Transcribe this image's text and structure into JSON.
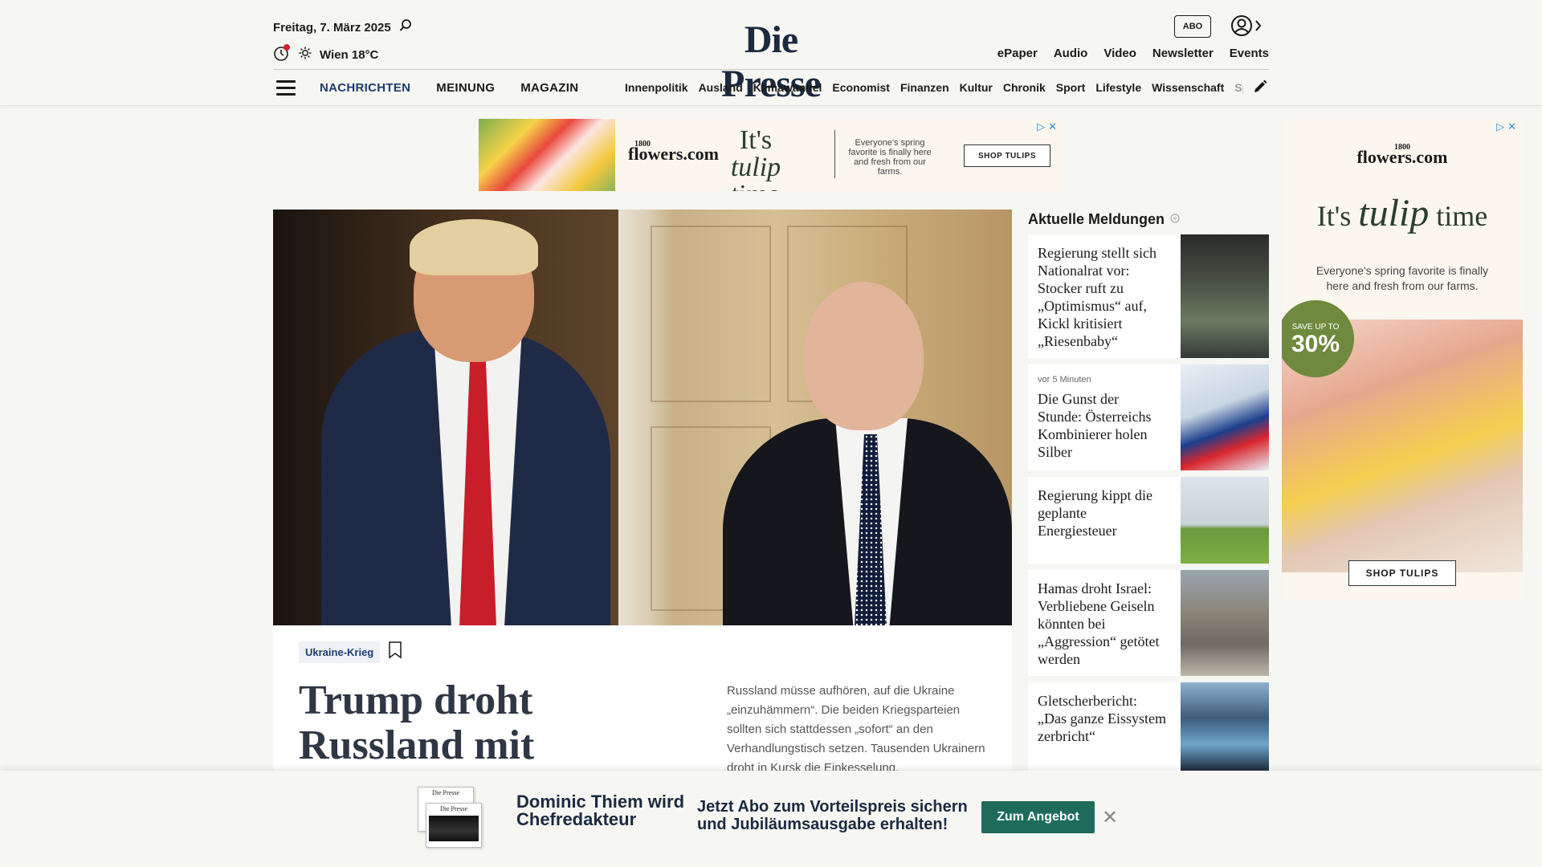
{
  "header": {
    "date": "Freitag, 7. März 2025",
    "weather": "Wien 18°C",
    "logo": "Die Presse",
    "abo_label": "ABO",
    "util_links": [
      "ePaper",
      "Audio",
      "Video",
      "Newsletter",
      "Events"
    ],
    "main_nav": [
      "NACHRICHTEN",
      "MEINUNG",
      "MAGAZIN"
    ],
    "sub_nav": [
      "Innenpolitik",
      "Ausland",
      "Klimawandel",
      "Economist",
      "Finanzen",
      "Kultur",
      "Chronik",
      "Sport",
      "Lifestyle",
      "Wissenschaft",
      "Spectr"
    ]
  },
  "top_ad": {
    "brand_small": "1800",
    "brand": "flowers.com",
    "tagline_a": "It's",
    "tagline_b": "tulip",
    "tagline_c": "time",
    "subtext": "Everyone's spring favorite is finally here and fresh from our farms.",
    "cta": "SHOP TULIPS"
  },
  "article": {
    "kicker": "Ukraine-Krieg",
    "headline": "Trump droht Russland mit Bankensanktionen",
    "teaser": "Russland müsse aufhören, auf die Ukraine „einzuhämmern“. Die beiden Kriegsparteien sollten sich stattdessen „sofort“ an den Verhandlungstisch setzen. Tausenden Ukrainern droht in Kursk die Einkesselung."
  },
  "news": {
    "title": "Aktuelle Meldungen",
    "items": [
      {
        "time": "",
        "text": "Regierung stellt sich Nationalrat vor: Stocker ruft zu „Optimismus“ auf, Kickl kritisiert „Riesenbaby“"
      },
      {
        "time": "vor 5 Minuten",
        "text": "Die Gunst der Stunde: Österreichs Kombinierer holen Silber"
      },
      {
        "time": "",
        "text": "Regierung kippt die geplante Energiesteuer"
      },
      {
        "time": "",
        "text": "Hamas droht Israel: Verbliebene Geiseln könnten bei „Aggression“ getötet werden"
      },
      {
        "time": "",
        "text": "Gletscherbericht: „Das ganze Eissystem zerbricht“"
      }
    ]
  },
  "side_ad": {
    "brand_small": "1800",
    "brand": "flowers.com",
    "tagline_a": "It's",
    "tagline_b": "tulip",
    "tagline_c": "time",
    "subtext": "Everyone's spring favorite is finally here and fresh from our farms.",
    "badge_top": "SAVE UP TO",
    "badge_value": "30%",
    "cta": "SHOP TULIPS"
  },
  "promo": {
    "paper_logo": "Die Presse",
    "title": "Dominic Thiem wird Chefredakteur",
    "text": "Jetzt Abo zum Vorteilspreis sichern und Jubiläumsausgabe erhalten!",
    "cta": "Zum Angebot"
  }
}
